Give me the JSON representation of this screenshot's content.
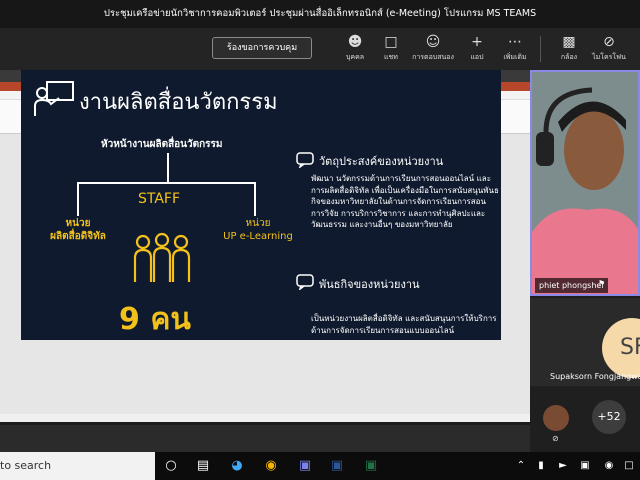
{
  "window": {
    "title": "ประชุมเครือข่ายนักวิชาการคอมพิวเตอร์ ประชุมผ่านสื่ออิเล็กทรอนิกส์ (e-Meeting) โปรแกรม MS TEAMS"
  },
  "toolbar": {
    "request_control": "ร้องขอการควบคุม",
    "people": "บุคคล",
    "chat": "แชท",
    "reactions": "การตอบสนอง",
    "apps": "แอป",
    "more": "เพิ่มเติม",
    "camera": "กล้อง",
    "mic": "ไมโครโฟน"
  },
  "slide": {
    "title": "งานผลิตสื่อนวัตกรรม",
    "head": "หัวหน้างานผลิตสื่อนวัตกรรม",
    "staff": "STAFF",
    "unit1_line1": "หน่วย",
    "unit1_line2": "ผลิตสื่อดิจิทัล",
    "unit2_line1": "หน่วย",
    "unit2_line2": "UP e-Learning",
    "count": "9 คน",
    "objective_heading": "วัตถุประสงค์ของหน่วยงาน",
    "objective_text": "พัฒนา นวัตกรรมด้านการเรียนการสอนออนไลน์ และการผลิตสื่อดิจิทัล เพื่อเป็นเครื่องมือในการสนับสนุนพันธกิจของมหาวิทยาลัยในด้านการจัดการเรียนการสอน การวิจัย การบริการวิชาการ และการทำนุศิลปะและวัฒนธรรม และงานอื่นๆ ของมหาวิทยาลัย",
    "mission_heading": "พันธกิจของหน่วยงาน",
    "mission_text": "เป็นหน่วยงานผลิตสื่อดิจิทัล และสนับสนุนการให้บริการด้านการจัดการเรียนการสอนแบบออนไลน์"
  },
  "participants": {
    "presenter_name": "phiet phongshei",
    "second_name": "Supaksorn Fongjangwang",
    "second_initials": "SF",
    "overflow": "+52"
  },
  "taskbar": {
    "search": "to search"
  }
}
